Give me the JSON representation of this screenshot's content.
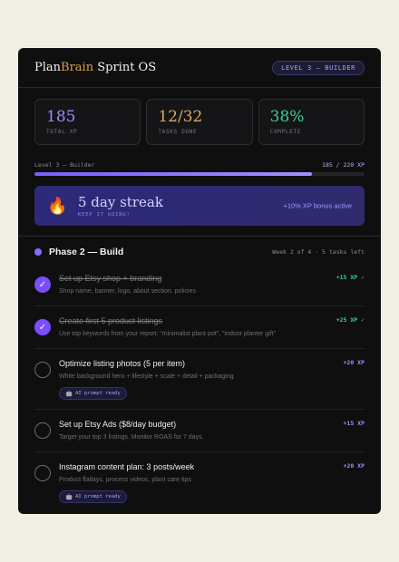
{
  "header": {
    "brand_a": "Plan",
    "brand_b": "Brain",
    "brand_c": " Sprint OS",
    "level_pill": "LEVEL 3 — BUILDER"
  },
  "stats": [
    {
      "value": "185",
      "label": "TOTAL XP"
    },
    {
      "value": "12/32",
      "label": "TASKS DONE"
    },
    {
      "value": "38%",
      "label": "COMPLETE"
    }
  ],
  "progress": {
    "label": "Level 3 — Builder",
    "count": "185 / 220 XP",
    "fraction": 0.84
  },
  "streak": {
    "icon": "flame-icon",
    "title": "5 day streak",
    "subtitle": "KEEP IT GOING!",
    "bonus": "+10% XP bonus active"
  },
  "phase": {
    "title": "Phase 2 — Build",
    "meta": "Week 2 of 4 · 5 tasks left"
  },
  "tasks": [
    {
      "title": "Set up Etsy shop + branding",
      "desc": "Shop name, banner, logo, about section, policies",
      "xp": "+15 XP ✓",
      "done": true
    },
    {
      "title": "Create first 5 product listings",
      "desc": "Use top keywords from your report: \"minimalist plant pot\", \"indoor planter gift\"",
      "xp": "+25 XP ✓",
      "done": true
    },
    {
      "title": "Optimize listing photos (5 per item)",
      "desc": "White background hero + lifestyle + scale + detail + packaging",
      "xp": "+20 XP",
      "done": false,
      "badge": "AI prompt ready"
    },
    {
      "title": "Set up Etsy Ads ($8/day budget)",
      "desc": "Target your top 3 listings. Monitor ROAS for 7 days.",
      "xp": "+15 XP",
      "done": false
    },
    {
      "title": "Instagram content plan: 3 posts/week",
      "desc": "Product flatlays, process videos, plant care tips",
      "xp": "+20 XP",
      "done": false,
      "badge": "AI prompt ready"
    }
  ],
  "colors": {
    "accent": "#7c4dff",
    "gold": "#d6a24a",
    "success": "#3fd08f"
  }
}
